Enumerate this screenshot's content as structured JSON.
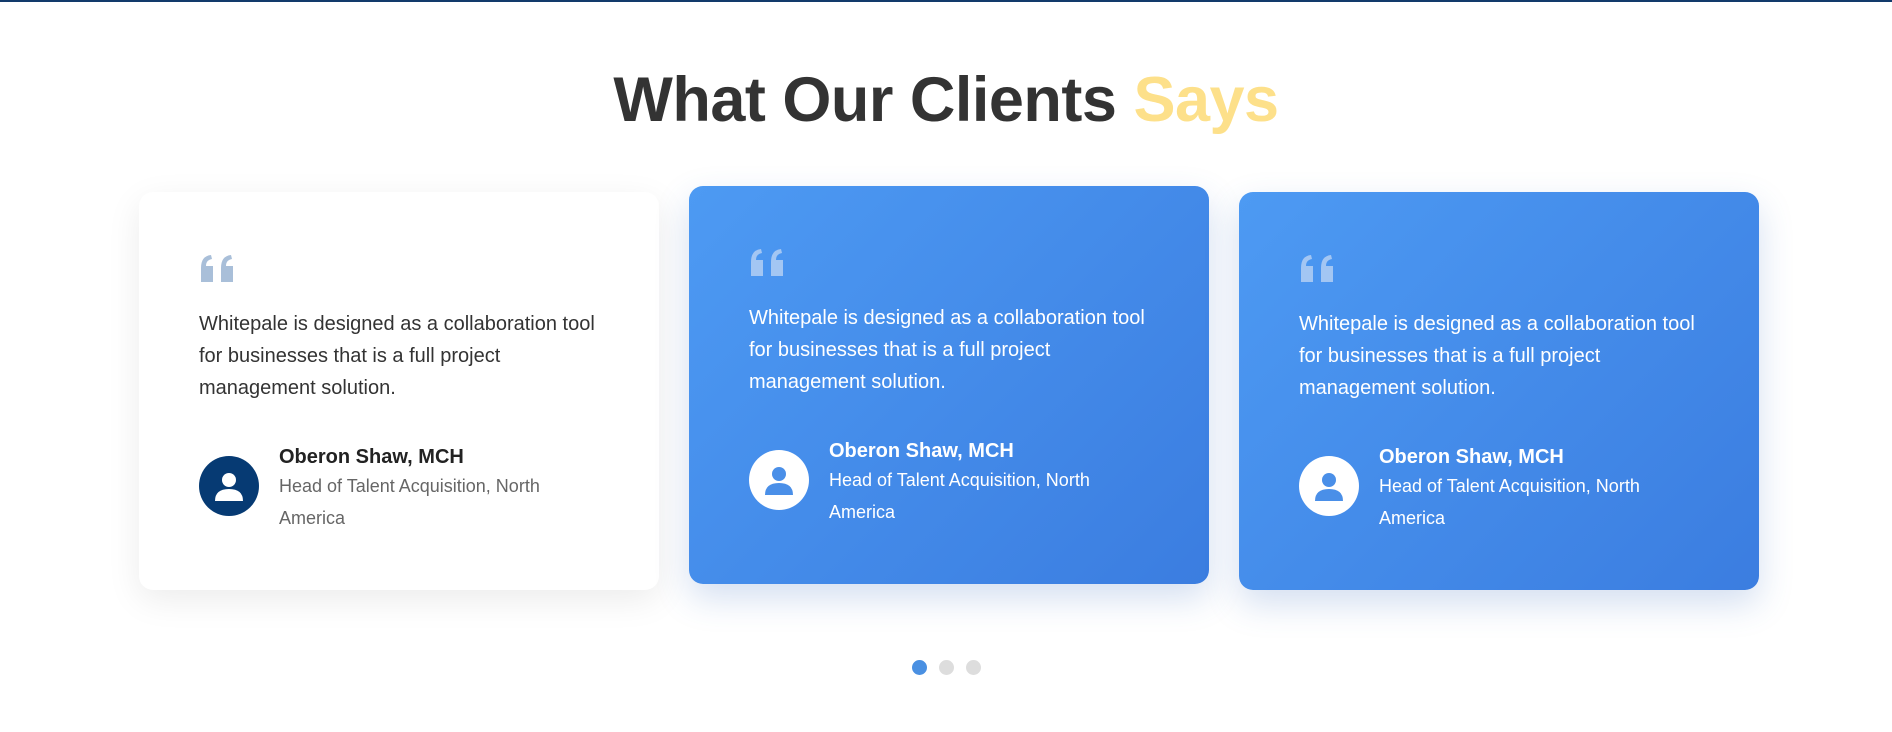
{
  "section": {
    "heading_main": "What Our Clients",
    "heading_accent": "Says"
  },
  "testimonials": [
    {
      "quote": "Whitepale is designed as a collaboration tool for businesses that is a full project management solution.",
      "name": "Oberon Shaw, MCH",
      "role": "Head of Talent Acquisition, North America",
      "style": "white",
      "icon": "quote-icon"
    },
    {
      "quote": "Whitepale is designed as a collaboration tool for businesses that is a full project management solution.",
      "name": "Oberon Shaw, MCH",
      "role": "Head of Talent Acquisition, North America",
      "style": "blue",
      "icon": "quote-icon"
    },
    {
      "quote": "Whitepale is designed as a collaboration tool for businesses that is a full project management solution.",
      "name": "Oberon Shaw, MCH",
      "role": "Head of Talent Acquisition, North America",
      "style": "blue",
      "icon": "quote-icon"
    }
  ],
  "carousel": {
    "dot_count": 3,
    "active_index": 0
  },
  "colors": {
    "accent": "#fde08a",
    "blue_card": "#4a90e2",
    "avatar_dark": "#063a73",
    "active_dot": "#4a90e2"
  }
}
